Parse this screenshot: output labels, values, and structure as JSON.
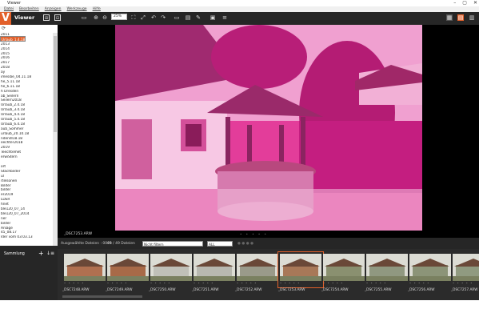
{
  "window": {
    "title": "Viewer",
    "controls": [
      "–",
      "▢",
      "✕"
    ]
  },
  "menu": [
    "Datei",
    "Bearbeiten",
    "Anzeigen",
    "Werkzeuge",
    "Hilfe"
  ],
  "app": {
    "logo": "V",
    "title": "Viewer"
  },
  "toolbar": {
    "zoom": "25%"
  },
  "folders": [
    "2011",
    "2012",
    "2013",
    "2014",
    "2015",
    "2016",
    "2017",
    "2018",
    "ay",
    "imesibe_04.11.18",
    "he_5.11.18",
    "he_6.11.18",
    "h Dresden",
    "ab_Seilern",
    "Seilern2018",
    "Urlaub_1.4.18",
    "Urlaub_2.4.18",
    "Urlaub_3.4.18",
    "Urlaub_4.4.18",
    "Urlaub_5.4.18",
    "Urlaub_6.4.18",
    "aub_Sommer",
    "urlaub_20.10.18",
    "ndendl18.18",
    "eechter2018",
    "2019",
    "Teechtemet",
    "erwiStern",
    "",
    "ort",
    "Stachbilder",
    "ul",
    "rtelsonen",
    "Bilder",
    "bilder",
    "er2019",
    "LDER",
    "hnet",
    "ble120_07_14",
    "ble120_07_2014",
    "ner",
    "bilder",
    "Anlage",
    "45_08.17",
    "lder vom 03.03.13"
  ],
  "selected_folder_index": 15,
  "sidebar_bottom": {
    "label": "Sammlung",
    "add": "+",
    "sort": "↓≡"
  },
  "viewer": {
    "filename": "_DSC7253.ARW",
    "dots": "• • • • •"
  },
  "filterbar": {
    "count_label": "Ausgewählte Dateien : 0001",
    "files": "49 / 49 Dateien",
    "filter": "Nicht filtern",
    "all": "ALL"
  },
  "thumbnails": [
    {
      "name": "_DSC7248.ARW",
      "color": "#b07050"
    },
    {
      "name": "_DSC7249.ARW",
      "color": "#a86a48"
    },
    {
      "name": "_DSC7250.ARW",
      "color": "#c0c0b8"
    },
    {
      "name": "_DSC7251.ARW",
      "color": "#b8b8b0"
    },
    {
      "name": "_DSC7252.ARW",
      "color": "#9a9a8a"
    },
    {
      "name": "_DSC7253.ARW",
      "color": "#a87858"
    },
    {
      "name": "_DSC7254.ARW",
      "color": "#8a9070"
    },
    {
      "name": "_DSC7255.ARW",
      "color": "#909880"
    },
    {
      "name": "_DSC7256.ARW",
      "color": "#8c9478"
    },
    {
      "name": "_DSC7257.ARW",
      "color": "#909a80"
    }
  ],
  "active_thumbnail": 5,
  "colors": {
    "accent": "#e2602a",
    "photo_tint": "#e0208a"
  }
}
